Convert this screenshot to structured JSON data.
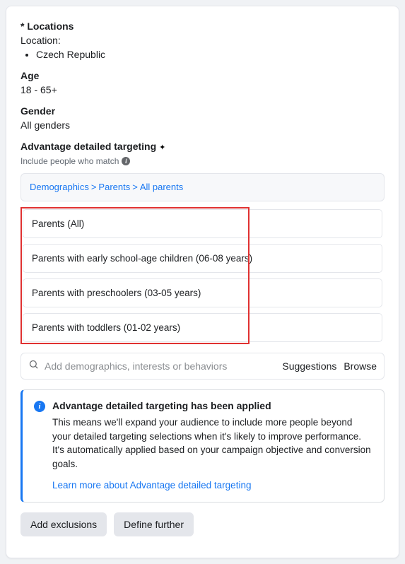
{
  "locations": {
    "label": "* Locations",
    "sublabel": "Location:",
    "items": [
      "Czech Republic"
    ]
  },
  "age": {
    "label": "Age",
    "value": "18 - 65+"
  },
  "gender": {
    "label": "Gender",
    "value": "All genders"
  },
  "targeting": {
    "label": "Advantage detailed targeting",
    "sublabel": "Include people who match",
    "breadcrumb": {
      "a": "Demographics",
      "b": "Parents",
      "c": "All parents"
    },
    "options": [
      "Parents (All)",
      "Parents with early school-age children (06-08 years)",
      "Parents with preschoolers (03-05 years)",
      "Parents with toddlers (01-02 years)"
    ],
    "search": {
      "placeholder": "Add demographics, interests or behaviors",
      "action_suggestions": "Suggestions",
      "action_browse": "Browse"
    }
  },
  "notice": {
    "title": "Advantage detailed targeting has been applied",
    "text": "This means we'll expand your audience to include more people beyond your detailed targeting selections when it's likely to improve performance. It's automatically applied based on your campaign objective and conversion goals.",
    "link": "Learn more about Advantage detailed targeting"
  },
  "buttons": {
    "exclusions": "Add exclusions",
    "define": "Define further"
  }
}
